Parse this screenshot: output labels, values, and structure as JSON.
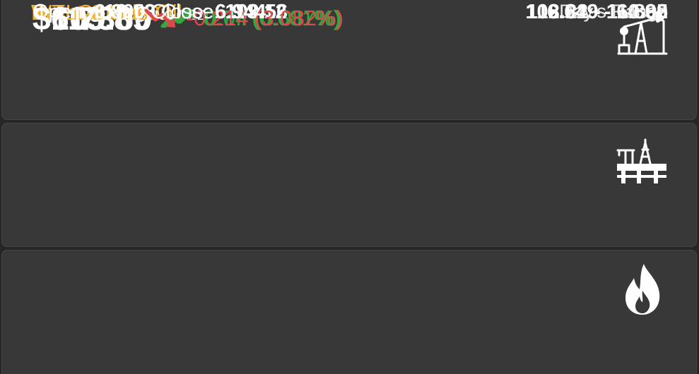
{
  "commodities": [
    {
      "name": "WTI Crude Oil",
      "symbol": "CL",
      "price": "$109.60",
      "trend": "up",
      "trend_icon": "trend-up-arrow-icon",
      "change": "0.04 (0.037%)",
      "open_label": "Open:",
      "open": "110.58",
      "close_label": "Close:",
      "close": "109.56",
      "range_label": "Day's Range",
      "range": "108.82 - 110.95",
      "icon": "oil-pump-jack-icon"
    },
    {
      "name": "Brent Crude Oil",
      "symbol": "BZ",
      "price": "$113.89",
      "trend": "up",
      "trend_icon": "trend-up-arrow-icon",
      "change": "0.77 (0.681%)",
      "open_label": "Open:",
      "open": "113.80",
      "close_label": "Close:",
      "close": "113.12",
      "range_label": "Day's Range",
      "range": "112.21 - 114.32",
      "icon": "offshore-oil-rig-icon"
    },
    {
      "name": "Natural Gas",
      "symbol": "NG",
      "price": "$6.730",
      "trend": "down",
      "trend_icon": "trend-down-arrow-icon",
      "change": "-0.214 (3.082%)",
      "open_label": "Open:",
      "open": "6.800",
      "close_label": "Close:",
      "close": "6.944",
      "range_label": "Day's Range",
      "range": "6.649 - 6.800",
      "icon": "gas-flame-icon"
    }
  ],
  "colors": {
    "background": "#262626",
    "card": "#383838",
    "name": "#f4b12f",
    "up": "#35a73f",
    "down": "#e0474c",
    "text": "#ffffff"
  }
}
